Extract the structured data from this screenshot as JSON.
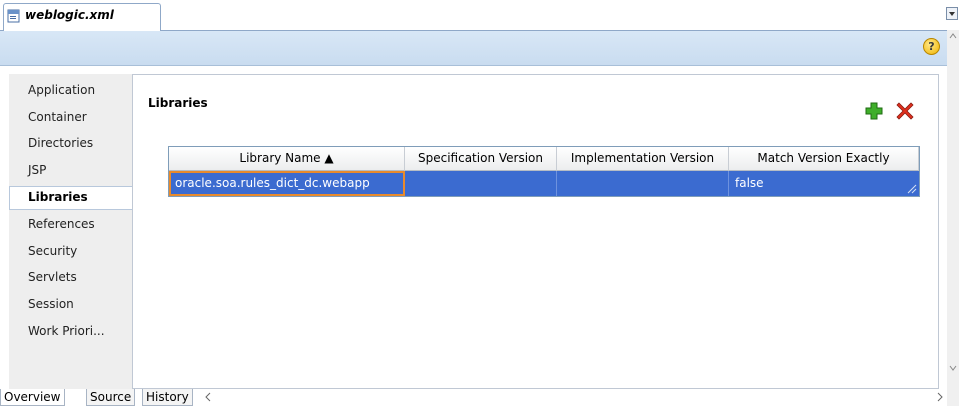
{
  "editor_tab": {
    "title": "weblogic.xml",
    "icon": "xml-file-icon"
  },
  "help": {
    "icon": "help-icon",
    "label": "?"
  },
  "sidebar": {
    "items": [
      {
        "label": "Application"
      },
      {
        "label": "Container"
      },
      {
        "label": "Directories"
      },
      {
        "label": "JSP"
      },
      {
        "label": "Libraries",
        "active": true
      },
      {
        "label": "References"
      },
      {
        "label": "Security"
      },
      {
        "label": "Servlets"
      },
      {
        "label": "Session"
      },
      {
        "label": "Work Priori..."
      }
    ]
  },
  "main": {
    "title": "Libraries",
    "add_icon": "add-icon",
    "delete_icon": "delete-icon",
    "table": {
      "columns": [
        "Library Name ▲",
        "Specification Version",
        "Implementation Version",
        "Match Version Exactly"
      ],
      "rows": [
        [
          "oracle.soa.rules_dict_dc.webapp",
          "",
          "",
          "false"
        ]
      ]
    }
  },
  "bottom_tabs": [
    {
      "label": "Overview",
      "active": true
    },
    {
      "label": "Source"
    },
    {
      "label": "History"
    }
  ],
  "colors": {
    "selection": "#3b6bd0",
    "focus_border": "#e88a2c",
    "header_band": "#c9dcf0"
  }
}
